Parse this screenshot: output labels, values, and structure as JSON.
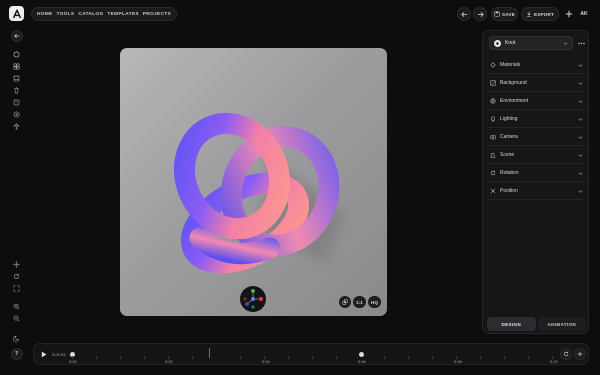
{
  "nav": {
    "items": [
      "HOME",
      "TOOLS",
      "CATALOG",
      "TEMPLATES",
      "PROJECTS"
    ]
  },
  "toolbar": {
    "save_label": "SAVE",
    "export_label": "EXPORT",
    "user_initials": "AK"
  },
  "canvas": {
    "ratio_label": "1:1",
    "quality_label": "HQ",
    "background_colors": [
      "#b7b7b9",
      "#8a8a8c"
    ],
    "knot_colors": [
      "#5b54f0",
      "#8b5cf6",
      "#f27fa8",
      "#ff9a8a"
    ]
  },
  "panel": {
    "preset_name": "Knot",
    "sections": [
      {
        "label": "Materials",
        "icon": "materials-icon"
      },
      {
        "label": "Background",
        "icon": "background-icon"
      },
      {
        "label": "Environment",
        "icon": "globe-icon"
      },
      {
        "label": "Lighting",
        "icon": "lightbulb-icon"
      },
      {
        "label": "Camera",
        "icon": "camera-icon"
      },
      {
        "label": "Scene",
        "icon": "scene-icon"
      },
      {
        "label": "Rotation",
        "icon": "rotation-icon"
      },
      {
        "label": "Position",
        "icon": "move-icon"
      }
    ],
    "tabs": {
      "design": "DESIGN",
      "animation": "ANIMATION"
    }
  },
  "timeline": {
    "current_time": "0:02.93",
    "labels": [
      "0:00",
      "0:02",
      "0:04",
      "0:06",
      "0:08",
      "0:10"
    ],
    "playhead_color": "#e23b3b"
  }
}
